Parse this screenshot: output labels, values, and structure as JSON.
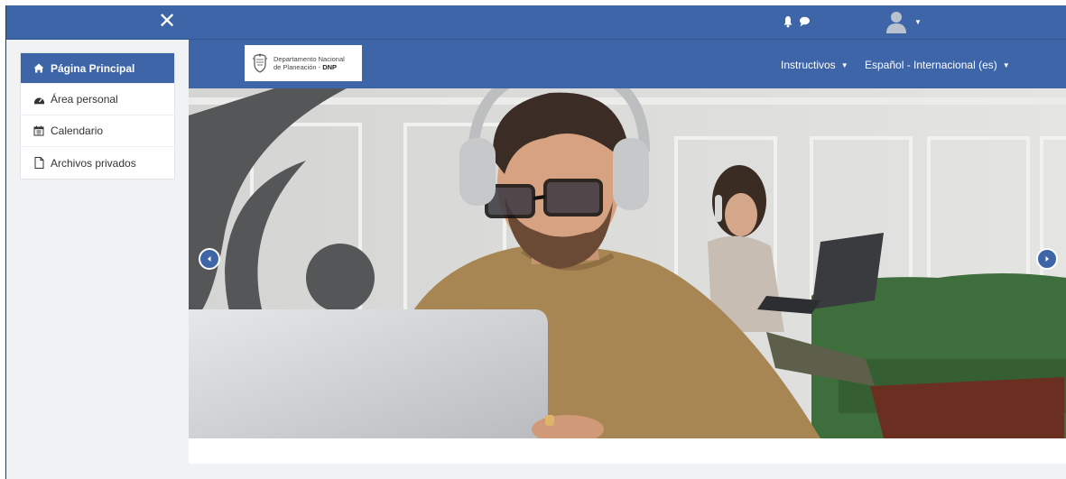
{
  "topbar": {
    "close_label": "✕"
  },
  "sidebar": {
    "items": [
      {
        "label": "Página Principal",
        "icon": "home-icon"
      },
      {
        "label": "Área personal",
        "icon": "dashboard-icon"
      },
      {
        "label": "Calendario",
        "icon": "calendar-icon"
      },
      {
        "label": "Archivos privados",
        "icon": "file-icon"
      }
    ]
  },
  "header": {
    "logo_line1": "Departamento Nacional",
    "logo_line2": "de Planeación - ",
    "logo_line2_bold": "DNP",
    "nav_instructivos": "Instructivos",
    "nav_language": "Español - Internacional (es)"
  },
  "colors": {
    "primary": "#3e65a8",
    "sidebar_bg": "#ffffff",
    "page_bg": "#f1f2f4"
  }
}
